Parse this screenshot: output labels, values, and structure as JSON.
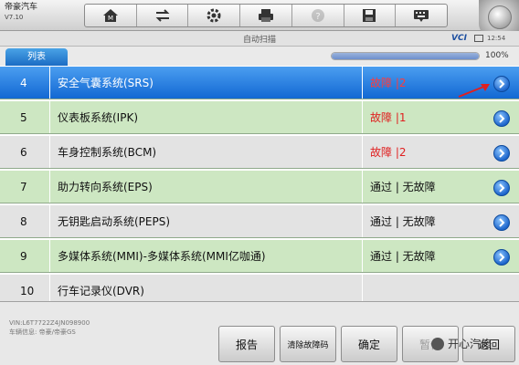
{
  "app": {
    "brand": "帝豪汽车",
    "version": "V7.10"
  },
  "toolbar": {
    "buttons": [
      {
        "icon": "home-icon",
        "enabled": true
      },
      {
        "icon": "swap-icon",
        "enabled": true
      },
      {
        "icon": "gear-icon",
        "enabled": true
      },
      {
        "icon": "printer-icon",
        "enabled": true
      },
      {
        "icon": "help-icon",
        "enabled": false
      },
      {
        "icon": "save-icon",
        "enabled": true
      },
      {
        "icon": "keyboard-icon",
        "enabled": true
      }
    ]
  },
  "header": {
    "title": "自动扫描",
    "vci": "VCI",
    "time": "12:54"
  },
  "tab": {
    "label": "列表"
  },
  "progress": {
    "percent_label": "100%",
    "value": 1.0
  },
  "rows": [
    {
      "num": "4",
      "name": "安全气囊系统(SRS)",
      "status": "故障 |2",
      "fault": true,
      "style": "selected"
    },
    {
      "num": "5",
      "name": "仪表板系统(IPK)",
      "status": "故障 |1",
      "fault": true,
      "style": "green"
    },
    {
      "num": "6",
      "name": "车身控制系统(BCM)",
      "status": "故障 |2",
      "fault": true,
      "style": "gray"
    },
    {
      "num": "7",
      "name": "助力转向系统(EPS)",
      "status": "通过 | 无故障",
      "fault": false,
      "style": "green"
    },
    {
      "num": "8",
      "name": "无钥匙启动系统(PEPS)",
      "status": "通过 | 无故障",
      "fault": false,
      "style": "gray"
    },
    {
      "num": "9",
      "name": "多媒体系统(MMI)-多媒体系统(MMI亿咖通)",
      "status": "通过 | 无故障",
      "fault": false,
      "style": "green"
    },
    {
      "num": "10",
      "name": "行车记录仪(DVR)",
      "status": "",
      "fault": false,
      "style": "gray"
    }
  ],
  "footer": {
    "vin_line": "VIN:L6T7722Z4JN098900",
    "path_line": "车辆信息: 帝豪/帝豪GS",
    "buttons": {
      "report": "报告",
      "clear_dtc": "清除故障码",
      "confirm": "确定",
      "pause": "暂停",
      "back": "返回"
    },
    "watermark": "开心汽修"
  },
  "colors": {
    "selected_row": "#1268d3",
    "fault_text": "#e02020",
    "green_row": "#cde7c2"
  }
}
